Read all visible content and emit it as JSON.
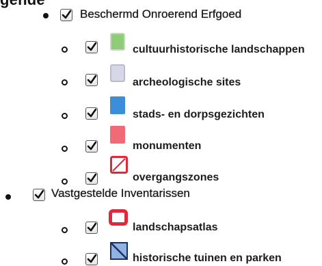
{
  "legend": {
    "title": "gende",
    "groups": [
      {
        "label": "Beschermd Onroerend Erfgoed",
        "checked": true,
        "items": [
          {
            "label": "cultuurhistorische landschappen",
            "checked": true,
            "swatch_color": "#8fcc7a"
          },
          {
            "label": "archeologische sites",
            "checked": true,
            "swatch_color": "#c9cbdf"
          },
          {
            "label": "stads- en dorpsgezichten",
            "checked": true,
            "swatch_color": "#3b8fd9"
          },
          {
            "label": "monumenten",
            "checked": true,
            "swatch_color": "#f06a78"
          },
          {
            "label": "overgangszones",
            "checked": true,
            "swatch_color": "#e0283a"
          }
        ]
      },
      {
        "label": "Vastgestelde Inventarissen",
        "checked": true,
        "items": [
          {
            "label": "landschapsatlas",
            "checked": true,
            "swatch_color": "#e0283a"
          },
          {
            "label": "historische tuinen en parken",
            "checked": true,
            "swatch_color": "#3a4f8f"
          }
        ]
      }
    ]
  }
}
